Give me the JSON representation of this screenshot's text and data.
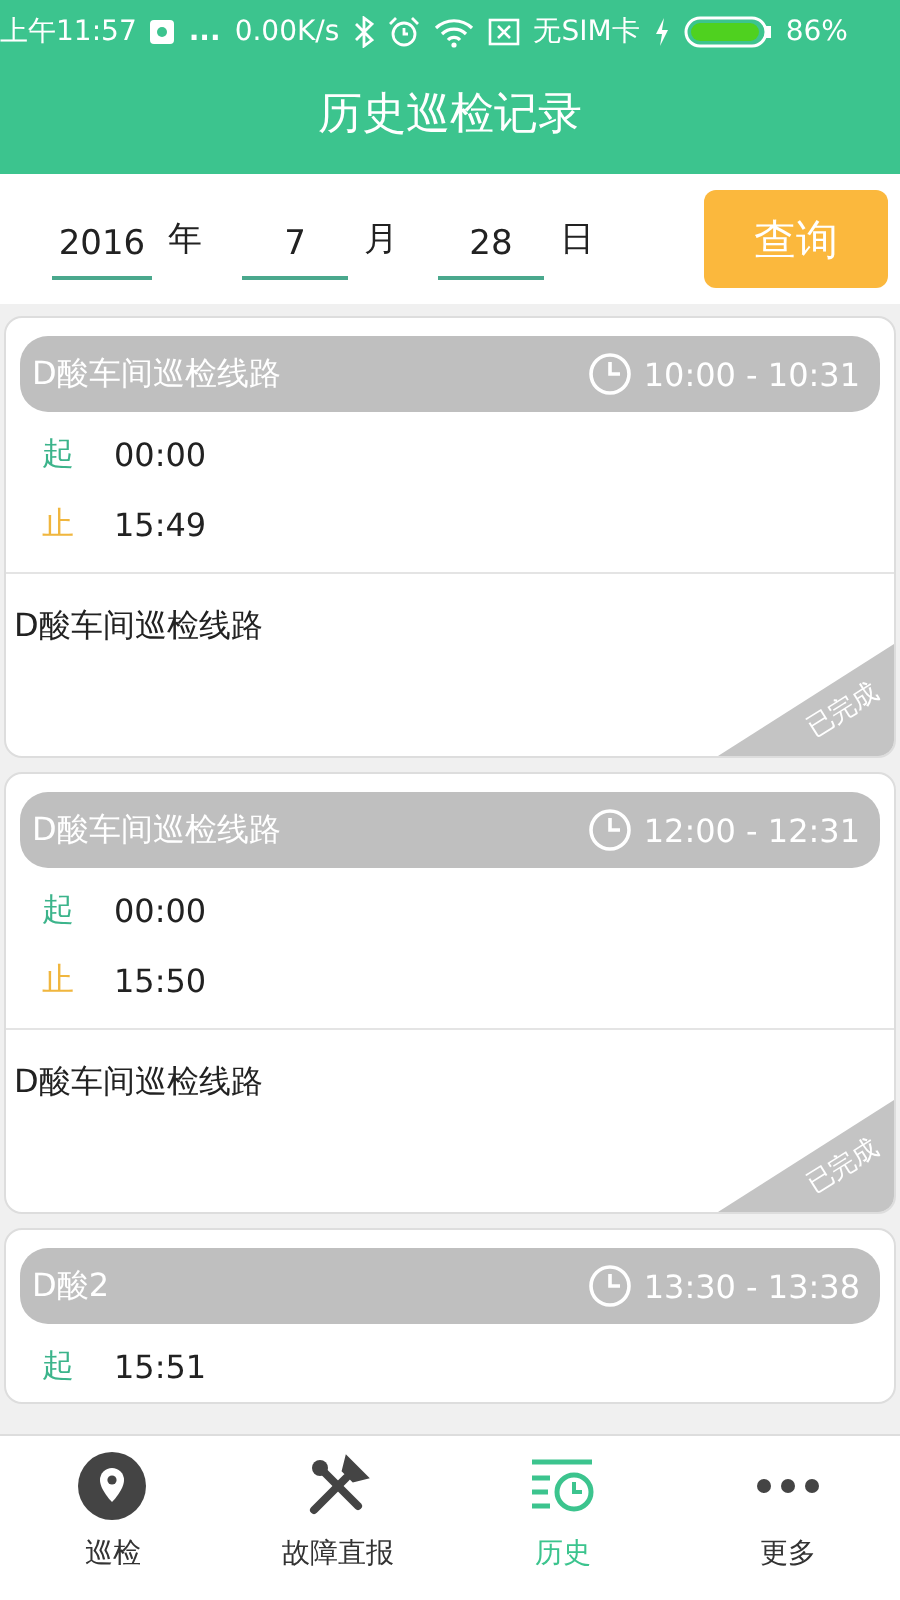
{
  "status_bar": {
    "time": "上午11:57",
    "dots": "...",
    "speed": "0.00K/s",
    "sim": "无SIM卡",
    "battery": "86%"
  },
  "header": {
    "title": "历史巡检记录"
  },
  "filter": {
    "year": {
      "value": "2016",
      "unit": "年"
    },
    "month": {
      "value": "7",
      "unit": "月"
    },
    "day": {
      "value": "28",
      "unit": "日"
    },
    "button": "查询"
  },
  "records": [
    {
      "route": "D酸车间巡检线路",
      "time_range": "10:00 - 10:31",
      "start_label": "起",
      "start": "00:00",
      "end_label": "止",
      "end": "15:49",
      "description": "D酸车间巡检线路",
      "status": "已完成"
    },
    {
      "route": "D酸车间巡检线路",
      "time_range": "12:00 - 12:31",
      "start_label": "起",
      "start": "00:00",
      "end_label": "止",
      "end": "15:50",
      "description": "D酸车间巡检线路",
      "status": "已完成"
    },
    {
      "route": "D酸2",
      "time_range": "13:30 - 13:38",
      "start_label": "起",
      "start": "15:51"
    }
  ],
  "tabs": [
    {
      "label": "巡检",
      "kind": "pin",
      "selected": false
    },
    {
      "label": "故障直报",
      "kind": "tools",
      "selected": false
    },
    {
      "label": "历史",
      "kind": "history",
      "selected": true
    },
    {
      "label": "更多",
      "kind": "more",
      "selected": false
    }
  ]
}
